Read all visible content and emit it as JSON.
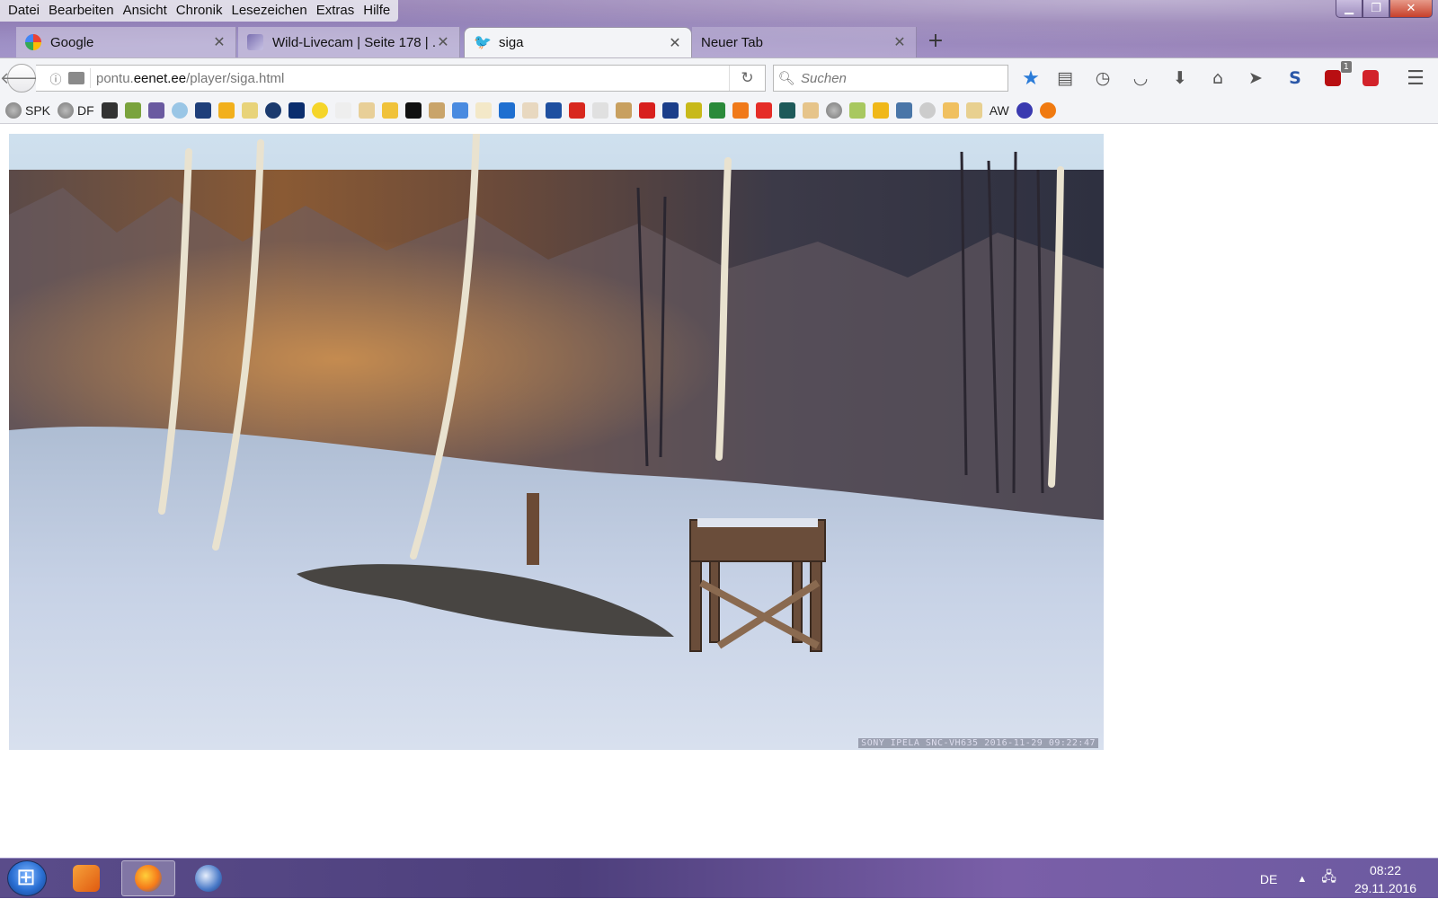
{
  "menubar": [
    "Datei",
    "Bearbeiten",
    "Ansicht",
    "Chronik",
    "Lesezeichen",
    "Extras",
    "Hilfe"
  ],
  "tabs": [
    {
      "title": "Google",
      "icon": "google-icon",
      "active": false
    },
    {
      "title": "Wild-Livecam | Seite 178 | ...",
      "icon": "forum-icon",
      "active": false
    },
    {
      "title": "siga",
      "icon": "bird-icon",
      "active": true
    },
    {
      "title": "Neuer Tab",
      "icon": "",
      "active": false
    }
  ],
  "navbar": {
    "url_host_prefix": "pontu.",
    "url_host_domain": "eenet.ee",
    "url_path": "/player/siga.html",
    "search_placeholder": "Suchen",
    "ublock_badge": "1"
  },
  "bookmarks": [
    {
      "label": "SPK",
      "icon": "globe-icon"
    },
    {
      "label": "DF",
      "icon": "globe-icon"
    },
    {
      "label": "AW",
      "icon": "globe-icon"
    }
  ],
  "webcam": {
    "overlay": "SONY IPELA SNC-VH635   2016-11-29 09:22:47"
  },
  "taskbar": {
    "lang": "DE",
    "time": "08:22",
    "date": "29.11.2016"
  },
  "colors": {
    "accent_blue": "#2a7bd8",
    "window_frame": "#9a86b8"
  }
}
